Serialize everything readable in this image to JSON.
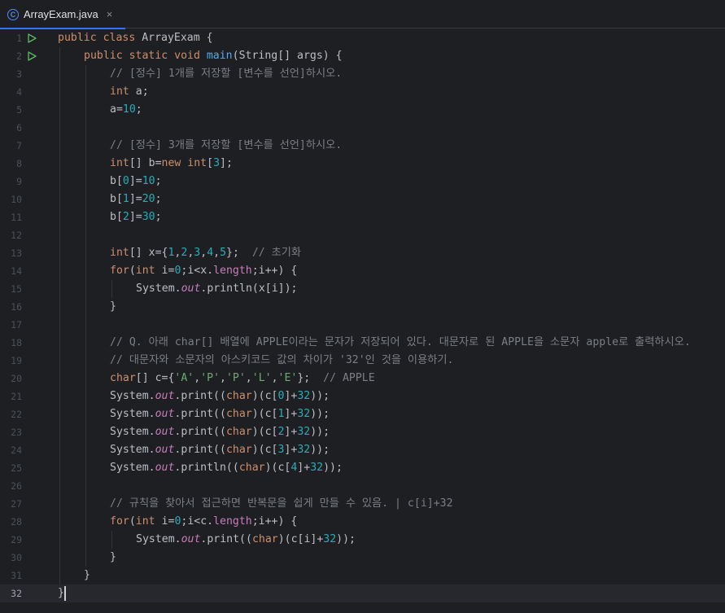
{
  "tab": {
    "filename": "ArrayExam.java",
    "icon": "class-c-icon",
    "class_letter": "C",
    "close_glyph": "×"
  },
  "editor": {
    "current_line": 32,
    "lines": [
      {
        "no": "1",
        "run": true,
        "indent": 0,
        "tokens": [
          [
            "k",
            "public "
          ],
          [
            "k",
            "class "
          ],
          [
            "t",
            "ArrayExam {"
          ]
        ]
      },
      {
        "no": "2",
        "run": true,
        "indent": 1,
        "tokens": [
          [
            "k",
            "public "
          ],
          [
            "k",
            "static "
          ],
          [
            "k",
            "void "
          ],
          [
            "f",
            "main"
          ],
          [
            "t",
            "(String[] args) {"
          ]
        ]
      },
      {
        "no": "3",
        "indent": 2,
        "tokens": [
          [
            "c",
            "// [정수] 1개를 저장할 [변수를 선언]하시오."
          ]
        ]
      },
      {
        "no": "4",
        "indent": 2,
        "tokens": [
          [
            "k",
            "int "
          ],
          [
            "t",
            "a;"
          ]
        ]
      },
      {
        "no": "5",
        "indent": 2,
        "tokens": [
          [
            "t",
            "a="
          ],
          [
            "n",
            "10"
          ],
          [
            "t",
            ";"
          ]
        ]
      },
      {
        "no": "6",
        "indent": 2,
        "tokens": []
      },
      {
        "no": "7",
        "indent": 2,
        "tokens": [
          [
            "c",
            "// [정수] 3개를 저장할 [변수를 선언]하시오."
          ]
        ]
      },
      {
        "no": "8",
        "indent": 2,
        "tokens": [
          [
            "k",
            "int"
          ],
          [
            "t",
            "[] b="
          ],
          [
            "k",
            "new "
          ],
          [
            "k",
            "int"
          ],
          [
            "t",
            "["
          ],
          [
            "n",
            "3"
          ],
          [
            "t",
            "];"
          ]
        ]
      },
      {
        "no": "9",
        "indent": 2,
        "tokens": [
          [
            "t",
            "b["
          ],
          [
            "n",
            "0"
          ],
          [
            "t",
            "]="
          ],
          [
            "n",
            "10"
          ],
          [
            "t",
            ";"
          ]
        ]
      },
      {
        "no": "10",
        "indent": 2,
        "tokens": [
          [
            "t",
            "b["
          ],
          [
            "n",
            "1"
          ],
          [
            "t",
            "]="
          ],
          [
            "n",
            "20"
          ],
          [
            "t",
            ";"
          ]
        ]
      },
      {
        "no": "11",
        "indent": 2,
        "tokens": [
          [
            "t",
            "b["
          ],
          [
            "n",
            "2"
          ],
          [
            "t",
            "]="
          ],
          [
            "n",
            "30"
          ],
          [
            "t",
            ";"
          ]
        ]
      },
      {
        "no": "12",
        "indent": 2,
        "tokens": []
      },
      {
        "no": "13",
        "indent": 2,
        "tokens": [
          [
            "k",
            "int"
          ],
          [
            "t",
            "[] x={"
          ],
          [
            "n",
            "1"
          ],
          [
            "t",
            ","
          ],
          [
            "n",
            "2"
          ],
          [
            "t",
            ","
          ],
          [
            "n",
            "3"
          ],
          [
            "t",
            ","
          ],
          [
            "n",
            "4"
          ],
          [
            "t",
            ","
          ],
          [
            "n",
            "5"
          ],
          [
            "t",
            "};  "
          ],
          [
            "c",
            "// 초기화"
          ]
        ]
      },
      {
        "no": "14",
        "indent": 2,
        "tokens": [
          [
            "k",
            "for"
          ],
          [
            "t",
            "("
          ],
          [
            "k",
            "int "
          ],
          [
            "t",
            "i="
          ],
          [
            "n",
            "0"
          ],
          [
            "t",
            ";i<x."
          ],
          [
            "p",
            "length"
          ],
          [
            "t",
            ";i++) {"
          ]
        ]
      },
      {
        "no": "15",
        "indent": 3,
        "tokens": [
          [
            "t",
            "System."
          ],
          [
            "it",
            "out"
          ],
          [
            "t",
            ".println(x[i]);"
          ]
        ]
      },
      {
        "no": "16",
        "indent": 2,
        "tokens": [
          [
            "t",
            "}"
          ]
        ]
      },
      {
        "no": "17",
        "indent": 2,
        "tokens": []
      },
      {
        "no": "18",
        "indent": 2,
        "tokens": [
          [
            "c",
            "// Q. 아래 char[] 배열에 APPLE이라는 문자가 저장되어 있다. 대문자로 된 APPLE을 소문자 apple로 출력하시오."
          ]
        ]
      },
      {
        "no": "19",
        "indent": 2,
        "tokens": [
          [
            "c",
            "// 대문자와 소문자의 아스키코드 값의 차이가 '32'인 것을 이용하기."
          ]
        ]
      },
      {
        "no": "20",
        "indent": 2,
        "tokens": [
          [
            "k",
            "char"
          ],
          [
            "t",
            "[] c={"
          ],
          [
            "s",
            "'A'"
          ],
          [
            "t",
            ","
          ],
          [
            "s",
            "'P'"
          ],
          [
            "t",
            ","
          ],
          [
            "s",
            "'P'"
          ],
          [
            "t",
            ","
          ],
          [
            "s",
            "'L'"
          ],
          [
            "t",
            ","
          ],
          [
            "s",
            "'E'"
          ],
          [
            "t",
            "};  "
          ],
          [
            "c",
            "// APPLE"
          ]
        ]
      },
      {
        "no": "21",
        "indent": 2,
        "tokens": [
          [
            "t",
            "System."
          ],
          [
            "it",
            "out"
          ],
          [
            "t",
            ".print(("
          ],
          [
            "k",
            "char"
          ],
          [
            "t",
            ")(c["
          ],
          [
            "n",
            "0"
          ],
          [
            "t",
            "]+"
          ],
          [
            "n",
            "32"
          ],
          [
            "t",
            "));"
          ]
        ]
      },
      {
        "no": "22",
        "indent": 2,
        "tokens": [
          [
            "t",
            "System."
          ],
          [
            "it",
            "out"
          ],
          [
            "t",
            ".print(("
          ],
          [
            "k",
            "char"
          ],
          [
            "t",
            ")(c["
          ],
          [
            "n",
            "1"
          ],
          [
            "t",
            "]+"
          ],
          [
            "n",
            "32"
          ],
          [
            "t",
            "));"
          ]
        ]
      },
      {
        "no": "23",
        "indent": 2,
        "tokens": [
          [
            "t",
            "System."
          ],
          [
            "it",
            "out"
          ],
          [
            "t",
            ".print(("
          ],
          [
            "k",
            "char"
          ],
          [
            "t",
            ")(c["
          ],
          [
            "n",
            "2"
          ],
          [
            "t",
            "]+"
          ],
          [
            "n",
            "32"
          ],
          [
            "t",
            "));"
          ]
        ]
      },
      {
        "no": "24",
        "indent": 2,
        "tokens": [
          [
            "t",
            "System."
          ],
          [
            "it",
            "out"
          ],
          [
            "t",
            ".print(("
          ],
          [
            "k",
            "char"
          ],
          [
            "t",
            ")(c["
          ],
          [
            "n",
            "3"
          ],
          [
            "t",
            "]+"
          ],
          [
            "n",
            "32"
          ],
          [
            "t",
            "));"
          ]
        ]
      },
      {
        "no": "25",
        "indent": 2,
        "tokens": [
          [
            "t",
            "System."
          ],
          [
            "it",
            "out"
          ],
          [
            "t",
            ".println(("
          ],
          [
            "k",
            "char"
          ],
          [
            "t",
            ")(c["
          ],
          [
            "n",
            "4"
          ],
          [
            "t",
            "]+"
          ],
          [
            "n",
            "32"
          ],
          [
            "t",
            "));"
          ]
        ]
      },
      {
        "no": "26",
        "indent": 2,
        "tokens": []
      },
      {
        "no": "27",
        "indent": 2,
        "tokens": [
          [
            "c",
            "// 규칙을 찾아서 접근하면 반복문을 쉽게 만들 수 있음. | c[i]+32"
          ]
        ]
      },
      {
        "no": "28",
        "indent": 2,
        "tokens": [
          [
            "k",
            "for"
          ],
          [
            "t",
            "("
          ],
          [
            "k",
            "int "
          ],
          [
            "t",
            "i="
          ],
          [
            "n",
            "0"
          ],
          [
            "t",
            ";i<c."
          ],
          [
            "p",
            "length"
          ],
          [
            "t",
            ";i++) {"
          ]
        ]
      },
      {
        "no": "29",
        "indent": 3,
        "tokens": [
          [
            "t",
            "System."
          ],
          [
            "it",
            "out"
          ],
          [
            "t",
            ".print(("
          ],
          [
            "k",
            "char"
          ],
          [
            "t",
            ")(c[i]+"
          ],
          [
            "n",
            "32"
          ],
          [
            "t",
            "));"
          ]
        ]
      },
      {
        "no": "30",
        "indent": 2,
        "tokens": [
          [
            "t",
            "}"
          ]
        ]
      },
      {
        "no": "31",
        "indent": 1,
        "tokens": [
          [
            "t",
            "}"
          ]
        ]
      },
      {
        "no": "32",
        "indent": 0,
        "tokens": [
          [
            "t",
            "}"
          ]
        ]
      }
    ]
  }
}
